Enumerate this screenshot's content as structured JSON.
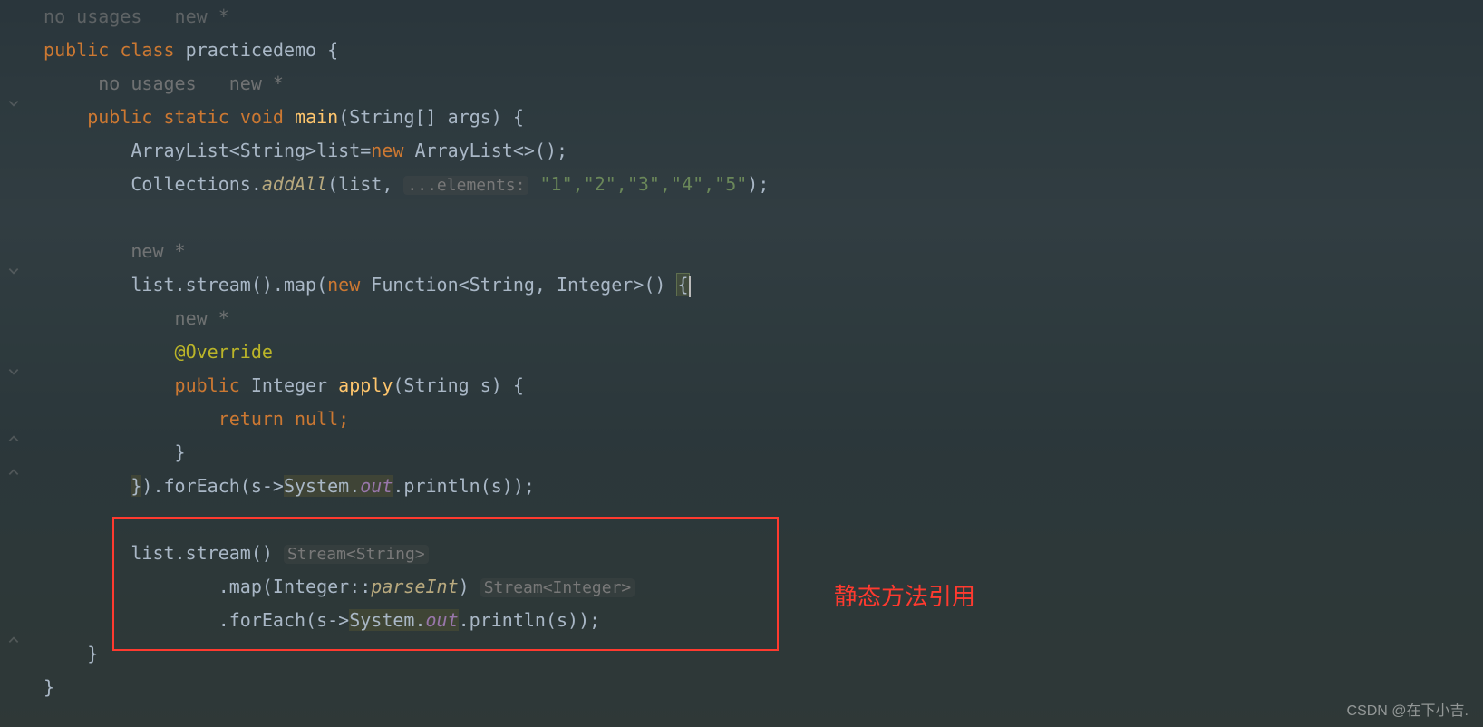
{
  "hints": {
    "top_usages": "no usages",
    "top_newstar": "new *",
    "main_usages": "no usages",
    "main_newstar": "new *",
    "inner_newstar": "new *",
    "apply_newstar": "new *",
    "elements": "...elements:"
  },
  "kw": {
    "public": "public",
    "class": "class",
    "static": "static",
    "void": "void",
    "new": "new",
    "return": "return",
    "null": "null"
  },
  "classname": "practicedemo",
  "main": "main",
  "mainparams": "(String[] args) {",
  "line_arraylist_a": "ArrayList<String>list=",
  "line_arraylist_b": " ArrayList<>();",
  "line_collections_a": "Collections.",
  "line_collections_addall": "addAll",
  "line_collections_b": "(list, ",
  "line_collections_strs": "\"1\",\"2\",\"3\",\"4\",\"5\"",
  "line_collections_c": ");",
  "line_stream_a": "list.stream().map(",
  "line_stream_b": " Function<String, Integer>() ",
  "ann_override": "@Override",
  "apply_a": " Integer ",
  "apply_name": "apply",
  "apply_b": "(String s) {",
  "return_null": " null;",
  "brace_close": "}",
  "foreach_a": ").forEach(s->",
  "sysout_a": "System.",
  "sysout_out": "out",
  "sysout_b": ".println(s));",
  "block2_a": "list.stream() ",
  "block2_inlay1": "Stream<String>",
  "block2_map_a": ".map(Integer::",
  "block2_parseInt": "parseInt",
  "block2_map_b": ") ",
  "block2_inlay2": "Stream<Integer>",
  "block2_foreach_a": ".forEach(s->",
  "block2_foreach_b": ".println(s));",
  "red_label": "静态方法引用",
  "watermark": "CSDN @在下小吉.",
  "brace_open": "{"
}
